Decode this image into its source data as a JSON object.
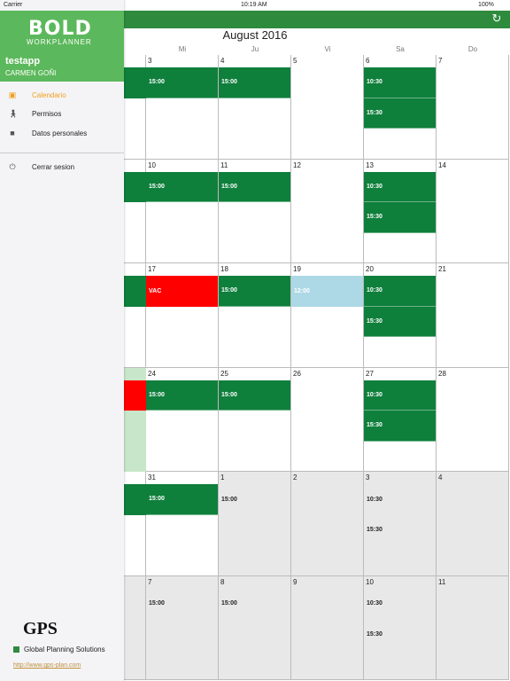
{
  "status_bar": {
    "carrier": "Carrier",
    "time": "10:19 AM",
    "battery": "100%"
  },
  "header": {
    "month_title": "August 2016",
    "refresh_icon": "refresh-icon"
  },
  "weekdays": [
    "Mi",
    "Ju",
    "Vi",
    "Sa",
    "Do"
  ],
  "sidebar": {
    "logo": "BOLD",
    "logo_sub": "WORKPLANNER",
    "user_name": "testapp",
    "user_full": "CARMEN GOÑI",
    "menu": [
      {
        "label": "Calendario",
        "icon": "calendar-icon",
        "active": true
      },
      {
        "label": "Permisos",
        "icon": "walking-person-icon",
        "active": false
      },
      {
        "label": "Datos personales",
        "icon": "id-card-icon",
        "active": false
      },
      {
        "label": "Cerrar sesion",
        "icon": "power-icon",
        "active": false
      }
    ],
    "footer": {
      "gps": "GPS",
      "company": "Global Planning Solutions",
      "link": "http://www.gps-plan.com"
    }
  },
  "weeks": [
    {
      "days": [
        {
          "num": "3",
          "other": false,
          "events": [
            {
              "text": "15:00",
              "color": "green"
            }
          ]
        },
        {
          "num": "4",
          "other": false,
          "events": [
            {
              "text": "15:00",
              "color": "green"
            }
          ]
        },
        {
          "num": "5",
          "other": false,
          "events": []
        },
        {
          "num": "6",
          "other": false,
          "events": [
            {
              "text": "10:30",
              "color": "green"
            },
            {
              "text": "15:30",
              "color": "green"
            }
          ]
        },
        {
          "num": "7",
          "other": false,
          "events": []
        }
      ]
    },
    {
      "days": [
        {
          "num": "10",
          "other": false,
          "events": [
            {
              "text": "15:00",
              "color": "green"
            }
          ]
        },
        {
          "num": "11",
          "other": false,
          "events": [
            {
              "text": "15:00",
              "color": "green"
            }
          ]
        },
        {
          "num": "12",
          "other": false,
          "events": []
        },
        {
          "num": "13",
          "other": false,
          "events": [
            {
              "text": "10:30",
              "color": "green"
            },
            {
              "text": "15:30",
              "color": "green"
            }
          ]
        },
        {
          "num": "14",
          "other": false,
          "events": []
        }
      ]
    },
    {
      "days": [
        {
          "num": "17",
          "other": false,
          "events": [
            {
              "text": "VAC",
              "color": "red"
            }
          ]
        },
        {
          "num": "18",
          "other": false,
          "events": [
            {
              "text": "15:00",
              "color": "green"
            }
          ]
        },
        {
          "num": "19",
          "other": false,
          "events": [
            {
              "text": "12:00",
              "color": "blue"
            }
          ]
        },
        {
          "num": "20",
          "other": false,
          "events": [
            {
              "text": "10:30",
              "color": "green"
            },
            {
              "text": "15:30",
              "color": "green"
            }
          ]
        },
        {
          "num": "21",
          "other": false,
          "events": []
        }
      ]
    },
    {
      "days": [
        {
          "num": "24",
          "other": false,
          "events": [
            {
              "text": "15:00",
              "color": "green"
            }
          ]
        },
        {
          "num": "25",
          "other": false,
          "events": [
            {
              "text": "15:00",
              "color": "green"
            }
          ]
        },
        {
          "num": "26",
          "other": false,
          "events": []
        },
        {
          "num": "27",
          "other": false,
          "events": [
            {
              "text": "10:30",
              "color": "green"
            },
            {
              "text": "15:30",
              "color": "green"
            }
          ]
        },
        {
          "num": "28",
          "other": false,
          "events": []
        }
      ]
    },
    {
      "days": [
        {
          "num": "31",
          "other": false,
          "events": [
            {
              "text": "15:00",
              "color": "green"
            }
          ]
        },
        {
          "num": "1",
          "other": true,
          "events": [
            {
              "text": "15:00",
              "color": "plain"
            }
          ]
        },
        {
          "num": "2",
          "other": true,
          "events": []
        },
        {
          "num": "3",
          "other": true,
          "events": [
            {
              "text": "10:30",
              "color": "plain"
            },
            {
              "text": "15:30",
              "color": "plain"
            }
          ]
        },
        {
          "num": "4",
          "other": true,
          "events": []
        }
      ]
    },
    {
      "days": [
        {
          "num": "7",
          "other": true,
          "events": [
            {
              "text": "15:00",
              "color": "plain"
            }
          ]
        },
        {
          "num": "8",
          "other": true,
          "events": [
            {
              "text": "15:00",
              "color": "plain"
            }
          ]
        },
        {
          "num": "9",
          "other": true,
          "events": []
        },
        {
          "num": "10",
          "other": true,
          "events": [
            {
              "text": "10:30",
              "color": "plain"
            },
            {
              "text": "15:30",
              "color": "plain"
            }
          ]
        },
        {
          "num": "11",
          "other": true,
          "events": []
        }
      ]
    }
  ],
  "colors": {
    "green": "#0f7f3c",
    "header_green": "#2e8b3e",
    "sidebar_green": "#5cb85c",
    "red": "#ff0000",
    "blue": "#add8e6",
    "accent": "#f0a020"
  }
}
